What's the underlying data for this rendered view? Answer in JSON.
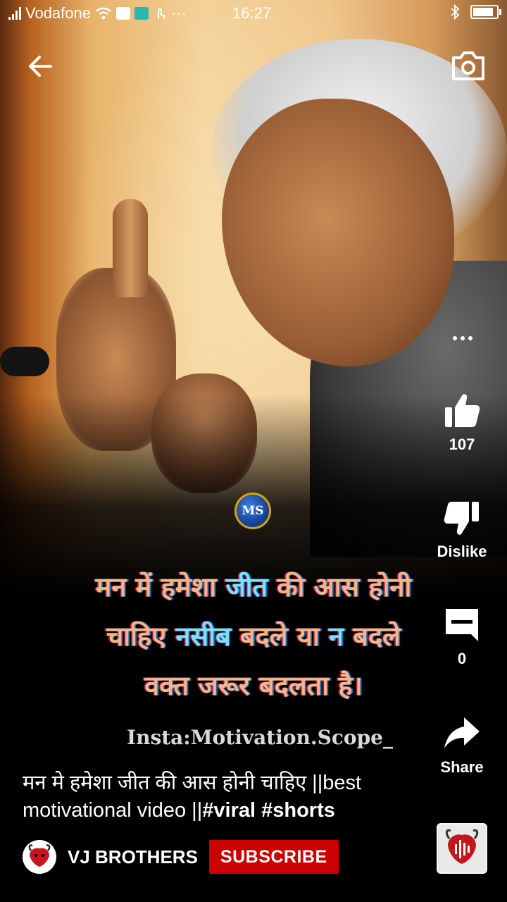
{
  "status_bar": {
    "carrier": "Vodafone",
    "time": "16:27",
    "dots": "···"
  },
  "video": {
    "ms_logo": "MS",
    "quote_line1": [
      "मन में हमेशा ",
      "जीत",
      " की आस होनी"
    ],
    "quote_line2": [
      "चाहिए ",
      "नसीब",
      " बदले या ",
      "न",
      " बदले"
    ],
    "quote_line3": [
      "वक्त जरूर बदलता है।"
    ],
    "credit": "Insta:Motivation.Scope_"
  },
  "actions": {
    "like_count": "107",
    "dislike_label": "Dislike",
    "comment_count": "0",
    "share_label": "Share"
  },
  "info": {
    "title_plain": "मन मे हमेशा जीत की आस होनी चाहिए ||best motivational video ||",
    "title_tags": "#viral #shorts",
    "channel_name": "VJ BROTHERS",
    "subscribe_label": "SUBSCRIBE"
  },
  "colors": {
    "subscribe": "#cc0000",
    "quote": "#ffb38a",
    "quote_highlight": "#7fe0ff"
  },
  "icons": [
    "back-arrow-icon",
    "camera-icon",
    "more-icon",
    "thumb-up-icon",
    "thumb-down-icon",
    "comment-icon",
    "share-icon"
  ]
}
